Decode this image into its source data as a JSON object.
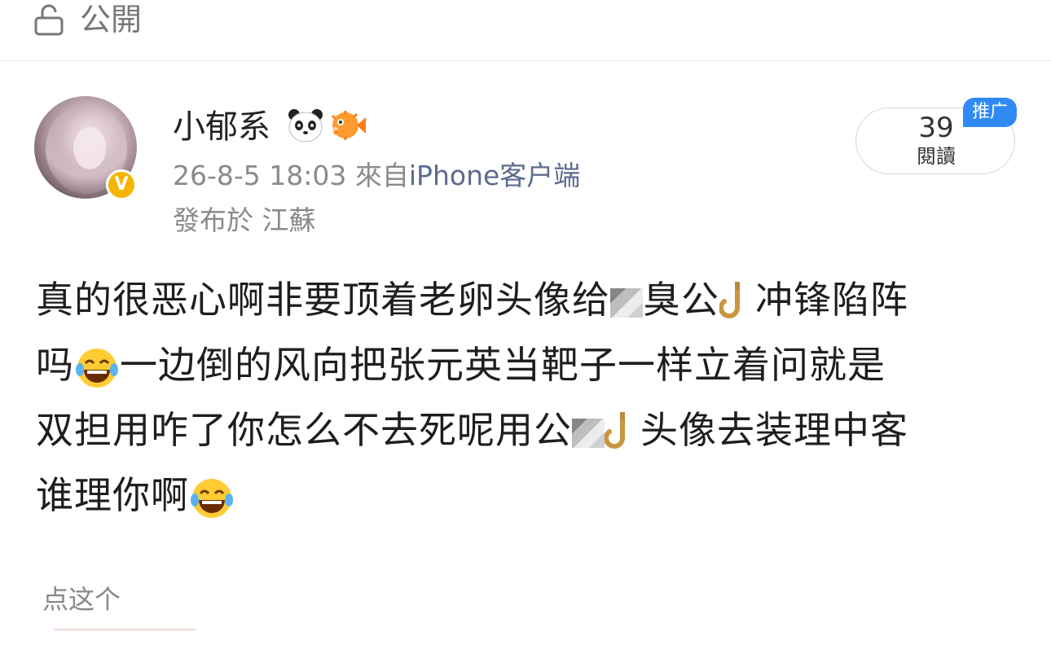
{
  "header": {
    "visibility_icon": "lock-icon",
    "visibility_label": "公開"
  },
  "post": {
    "author": {
      "name": "小郁系",
      "badge_icons": [
        "panda-emoji-icon",
        "pufferfish-emoji-icon"
      ],
      "verified_icon": "verified-badge-icon",
      "verified_mark": "V"
    },
    "timestamp": "26-8-5 18:03",
    "source_prefix": "來自",
    "source_client": "iPhone客户端",
    "location_prefix": "發布於",
    "location": "江蘇",
    "read_count": "39",
    "read_label": "閱讀",
    "promo_badge": "推广",
    "content": {
      "line1_a": "真的很恶心啊非要顶着老卵头像给",
      "line1_b": "冲锋陷阵",
      "line2_a": "吗",
      "line2_b": "一边倒的风向把张元英当靶子一样立着问就是",
      "line3_a": "双担用咋了你怎么不去死呢用",
      "line3_b": "头像去装理中客",
      "line4_a": "谁理你啊",
      "censored_chars": [
        "臭",
        "公",
        "公"
      ]
    }
  },
  "footer": {
    "link_label": "点这个"
  }
}
